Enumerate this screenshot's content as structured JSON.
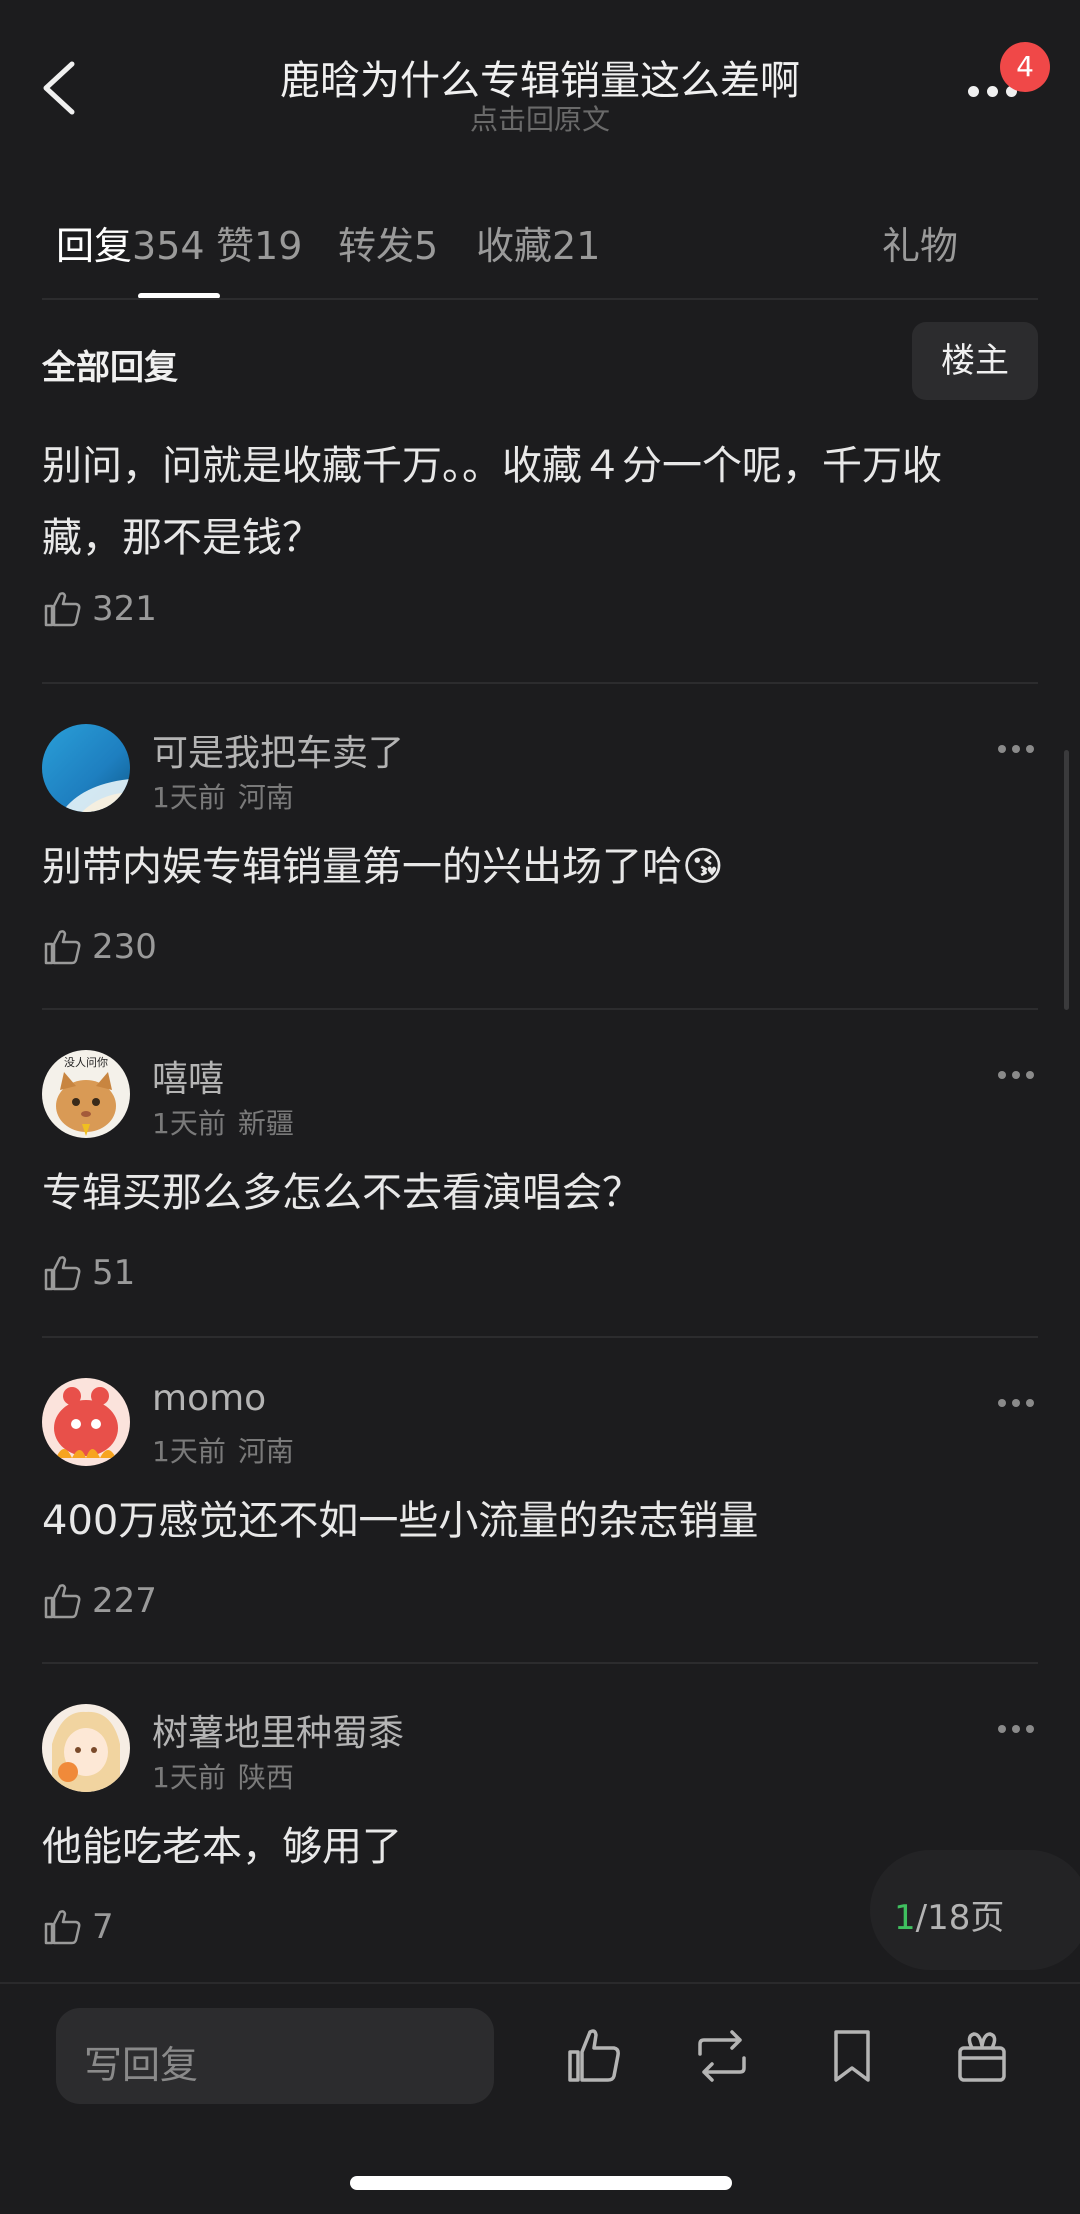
{
  "header": {
    "title": "鹿晗为什么专辑销量这么差啊",
    "subtitle": "点击回原文",
    "badge_count": "4"
  },
  "tabs": [
    {
      "label": "回复",
      "count": "354",
      "active": true
    },
    {
      "label": "赞",
      "count": "19"
    },
    {
      "label": "转发",
      "count": "5"
    },
    {
      "label": "收藏",
      "count": "21"
    },
    {
      "label": "礼物",
      "count": ""
    }
  ],
  "section": {
    "title": "全部回复",
    "owner_button": "楼主"
  },
  "top_comment": {
    "text_line1": "别问，问就是收藏千万。。收藏４分一个呢，千万收",
    "text_line2": "藏，那不是钱？",
    "likes": "321"
  },
  "comments": [
    {
      "username": "可是我把车卖了",
      "time": "1天前",
      "location": "河南",
      "text": "别带内娱专辑销量第一的兴出场了哈😘",
      "likes": "230"
    },
    {
      "username": "嘻嘻",
      "time": "1天前",
      "location": "新疆",
      "text": "专辑买那么多怎么不去看演唱会？",
      "likes": "51"
    },
    {
      "username": "momo",
      "time": "1天前",
      "location": "河南",
      "text": "400万感觉还不如一些小流量的杂志销量",
      "likes": "227"
    },
    {
      "username": "树薯地里种蜀黍",
      "time": "1天前",
      "location": "陕西",
      "text": "他能吃老本，够用了",
      "likes": "7"
    }
  ],
  "avatar_sticker_text": "没人问你",
  "pager": {
    "current": "1",
    "total": "/18页"
  },
  "bottom_bar": {
    "reply_placeholder": "写回复"
  },
  "colors": {
    "background": "#1c1c1e",
    "accent_green": "#3fbf5f",
    "badge_red": "#f04848"
  }
}
